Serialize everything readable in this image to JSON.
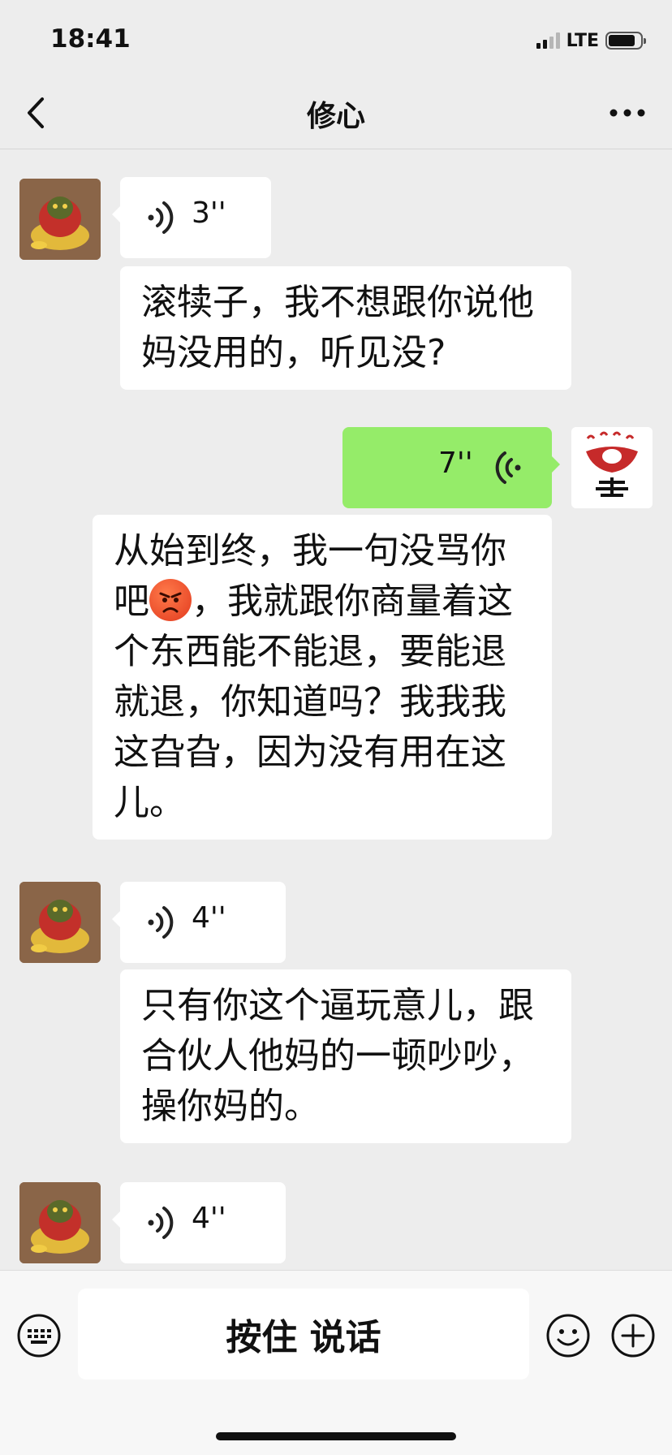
{
  "status_bar": {
    "time": "18:41",
    "network": "LTE"
  },
  "nav": {
    "title": "修心"
  },
  "messages": [
    {
      "type": "voice",
      "side": "left",
      "duration": "3''"
    },
    {
      "type": "text",
      "side": "left",
      "text": "滚犊子，我不想跟你说他妈没用的，听见没?"
    },
    {
      "type": "voice",
      "side": "right",
      "duration": "7''"
    },
    {
      "type": "text",
      "side": "right",
      "text_a": "从始到终，我一句没骂你吧",
      "emoji": "angry-face",
      "text_b": "，我就跟你商量着这个东西能不能退，要能退就退，你知道吗？我我我这旮旮，因为没有用在这儿。"
    },
    {
      "type": "voice",
      "side": "left",
      "duration": "4''"
    },
    {
      "type": "text",
      "side": "left",
      "text": "只有你这个逼玩意儿，跟合伙人他妈的一顿吵吵，操你妈的。"
    },
    {
      "type": "voice",
      "side": "left",
      "duration": "4''"
    }
  ],
  "input_bar": {
    "hold_to_talk_label": "按住 说话"
  },
  "colors": {
    "sent_bubble": "#95ec69",
    "received_bubble": "#ffffff",
    "background": "#ededed"
  }
}
